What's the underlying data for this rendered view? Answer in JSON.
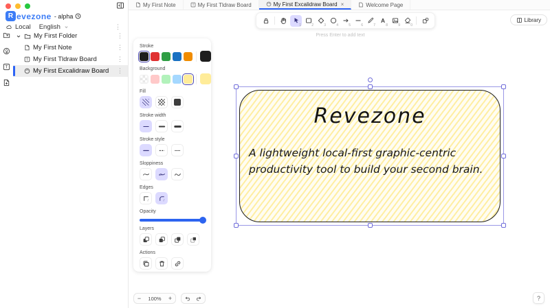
{
  "window": {
    "app_name": "Revezone",
    "app_badge_letter": "R",
    "app_suffix": "- alpha"
  },
  "sidebar": {
    "storage_label": "Local",
    "language_label": "English",
    "kebab_glyph": "⋮",
    "tree": {
      "folder_label": "My First Folder",
      "items": [
        {
          "label": "My First Note"
        },
        {
          "label": "My First Tldraw Board"
        },
        {
          "label": "My First Excalidraw Board",
          "selected": true
        }
      ]
    }
  },
  "tabs": [
    {
      "label": "My First Note"
    },
    {
      "label": "My First Tldraw Board"
    },
    {
      "label": "My First Excalidraw Board",
      "active": true,
      "close_glyph": "×"
    },
    {
      "label": "Welcome Page"
    }
  ],
  "toolbar": {
    "tools": [
      {
        "name": "lock",
        "shortcut": ""
      },
      {
        "name": "hand",
        "shortcut": ""
      },
      {
        "name": "selection",
        "shortcut": "1",
        "active": true
      },
      {
        "name": "rectangle",
        "shortcut": "2"
      },
      {
        "name": "diamond",
        "shortcut": "3"
      },
      {
        "name": "ellipse",
        "shortcut": "4"
      },
      {
        "name": "arrow",
        "shortcut": "5"
      },
      {
        "name": "line",
        "shortcut": "6"
      },
      {
        "name": "draw",
        "shortcut": "7"
      },
      {
        "name": "text",
        "shortcut": "8"
      },
      {
        "name": "image",
        "shortcut": "9"
      },
      {
        "name": "eraser",
        "shortcut": "0"
      },
      {
        "name": "more-tools",
        "shortcut": ""
      }
    ],
    "library_label": "Library",
    "hint": "Press Enter to add text"
  },
  "panel": {
    "stroke": {
      "label": "Stroke",
      "colors": [
        "#1e1e1e",
        "#e03131",
        "#2f9e44",
        "#1971c2",
        "#f08c00"
      ],
      "selected_index": 0,
      "current": "#1e1e1e"
    },
    "background": {
      "label": "Background",
      "colors": [
        "transparent",
        "#ffc9c9",
        "#b2f2bb",
        "#a5d8ff",
        "#ffec99"
      ],
      "selected_index": 4,
      "current": "#ffec99"
    },
    "fill": {
      "label": "Fill",
      "options": [
        "hachure",
        "cross-hatch",
        "solid"
      ],
      "selected_index": 0
    },
    "stroke_width": {
      "label": "Stroke width",
      "options": [
        "thin",
        "bold",
        "extra-bold"
      ],
      "selected_index": 0
    },
    "stroke_style": {
      "label": "Stroke style",
      "options": [
        "solid",
        "dashed",
        "dotted"
      ],
      "selected_index": 0
    },
    "sloppiness": {
      "label": "Sloppiness",
      "options": [
        "architect",
        "artist",
        "cartoonist"
      ],
      "selected_index": 1
    },
    "edges": {
      "label": "Edges",
      "options": [
        "sharp",
        "round"
      ],
      "selected_index": 1
    },
    "opacity": {
      "label": "Opacity",
      "value": 100
    },
    "layers": {
      "label": "Layers",
      "options": [
        "send-to-back",
        "send-backward",
        "bring-forward",
        "bring-to-front"
      ]
    },
    "actions": {
      "label": "Actions",
      "options": [
        "duplicate",
        "delete",
        "link"
      ]
    }
  },
  "canvas": {
    "card": {
      "title": "Revezone",
      "description_line1": "A lightweight local-first graphic-centric",
      "description_line2": "productivity tool to build your second brain."
    }
  },
  "footer": {
    "zoom_out_glyph": "−",
    "zoom_level": "100%",
    "zoom_in_glyph": "+",
    "help_glyph": "?"
  },
  "colors": {
    "accent_blue": "#2c63f5",
    "logo_blue": "#3b7cf6",
    "selected_tool_bg": "#dcdaff",
    "slider_blue": "#2d64f0",
    "shape_fill": "#ffec99",
    "shape_stroke": "#1e1e1e"
  }
}
